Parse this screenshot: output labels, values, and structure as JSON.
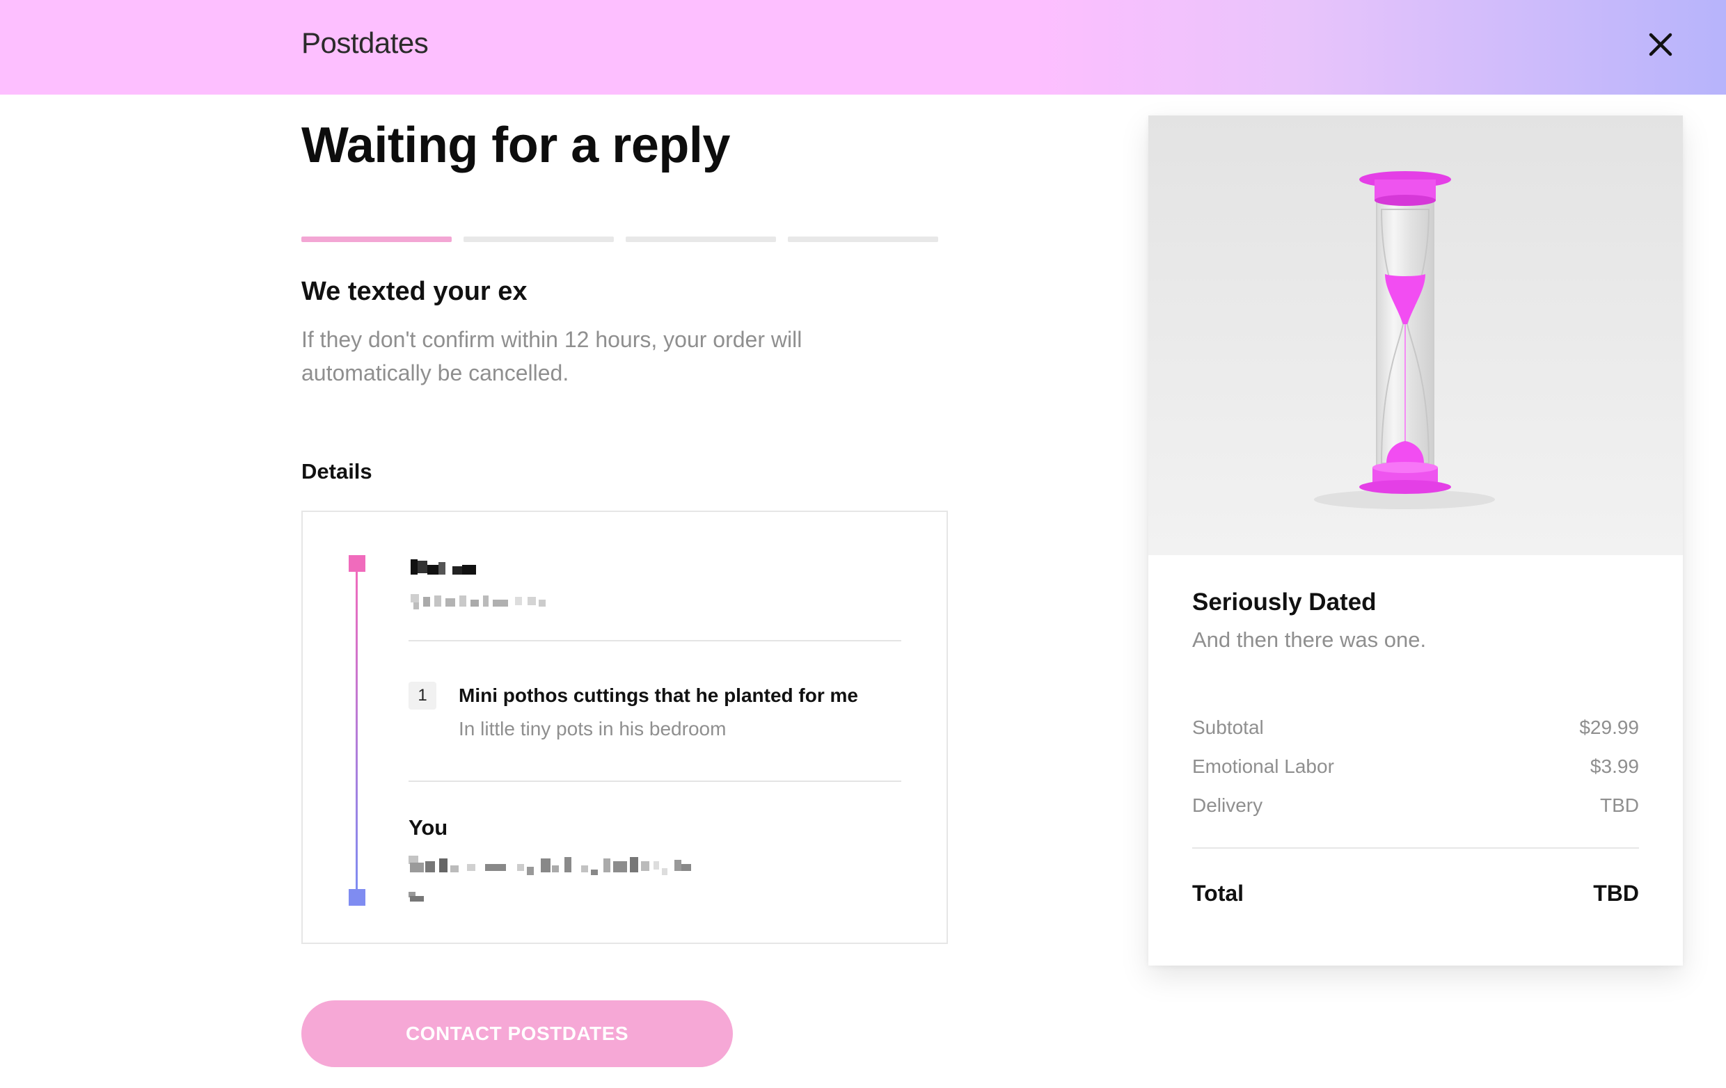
{
  "header": {
    "brand": "Postdates",
    "close_icon": "close-icon"
  },
  "main": {
    "title": "Waiting for a reply",
    "progress": {
      "total_steps": 4,
      "current_step": 1,
      "active_color": "#f3a6d4",
      "inactive_color": "#e8e8e8"
    },
    "step_title": "We texted your ex",
    "step_description": "If they don't confirm within 12 hours, your order will automatically be cancelled.",
    "details_label": "Details",
    "details": {
      "recipient_name_redacted": true,
      "recipient_address_redacted": true,
      "item": {
        "quantity": "1",
        "title": "Mini pothos cuttings that he planted for me",
        "subtitle": "In little tiny pots in his bedroom"
      },
      "sender_label": "You",
      "sender_message_redacted": true,
      "timeline_start_color": "#f06bbc",
      "timeline_end_color": "#7f8cf1"
    },
    "contact_button": "CONTACT POSTDATES"
  },
  "summary": {
    "image_icon": "hourglass-icon",
    "product_name": "Seriously Dated",
    "tagline": "And then there was one.",
    "rows": [
      {
        "label": "Subtotal",
        "value": "$29.99"
      },
      {
        "label": "Emotional Labor",
        "value": "$3.99"
      },
      {
        "label": "Delivery",
        "value": "TBD"
      }
    ],
    "total_label": "Total",
    "total_value": "TBD"
  },
  "colors": {
    "header_gradient_start": "#fdbfff",
    "header_gradient_end": "#b7b4fb",
    "accent_pink": "#f6a8d6",
    "hourglass_magenta": "#f24df2"
  }
}
